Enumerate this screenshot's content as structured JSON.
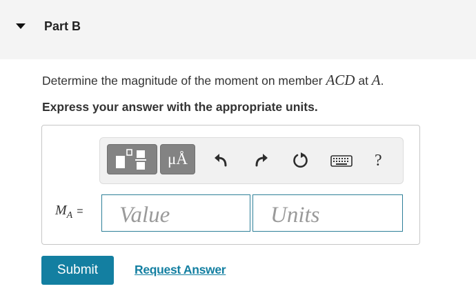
{
  "part": {
    "title": "Part B"
  },
  "question": {
    "text_before": "Determine the magnitude of the moment on member ",
    "member": "ACD",
    "text_middle": " at ",
    "point": "A",
    "text_after": ".",
    "instruction": "Express your answer with the appropriate units."
  },
  "toolbar": {
    "units_button": "μÅ",
    "help_button": "?",
    "icons": [
      "templates-icon",
      "units-icon",
      "undo-icon",
      "redo-icon",
      "reset-icon",
      "keyboard-icon",
      "help-icon"
    ]
  },
  "answer": {
    "variable": "M",
    "subscript": "A",
    "equals": "=",
    "value_placeholder": "Value",
    "units_placeholder": "Units"
  },
  "actions": {
    "submit_label": "Submit",
    "request_label": "Request Answer"
  },
  "colors": {
    "accent": "#137fa1",
    "header_bg": "#f4f4f4",
    "toolbar_button": "#838383"
  }
}
